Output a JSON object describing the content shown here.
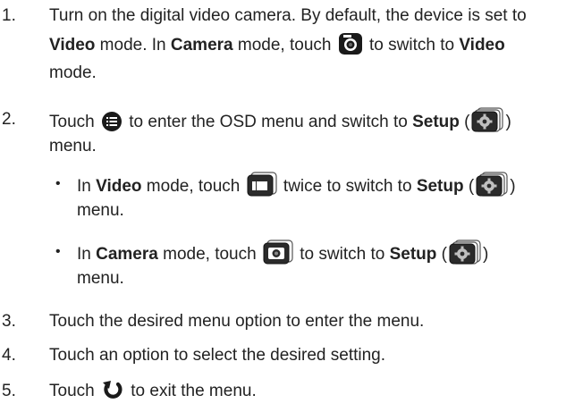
{
  "steps": [
    {
      "number": "1.",
      "line1": "Turn on the digital video camera. By default, the device is set to",
      "line2_mode1": "Video",
      "line2_mid": " mode. In ",
      "line2_mode2": "Camera",
      "line2_touch": " mode, touch ",
      "line2_after": " to switch to ",
      "line2_mode3": "Video",
      "line3": "mode.",
      "icon": "camera-mode-icon"
    },
    {
      "number": "2.",
      "touch": "Touch ",
      "after_icon": " to enter the OSD menu and switch to ",
      "setup": "Setup",
      "open_paren": " (",
      "close_paren": ")",
      "line2": "menu.",
      "icon": "menu-list-icon",
      "setup_icon": "setup-gear-icon",
      "bullets": [
        {
          "in": "In ",
          "mode": "Video",
          "touch": " mode, touch ",
          "after": " twice to switch to ",
          "setup": "Setup",
          "open_paren": " (",
          "close_paren": ")",
          "line2": "menu.",
          "icon": "video-tab-icon"
        },
        {
          "in": "In ",
          "mode": "Camera",
          "touch": " mode, touch ",
          "after": " to switch to ",
          "setup": "Setup",
          "open_paren": " (",
          "close_paren": ")",
          "line2": "menu.",
          "icon": "camera-tab-icon"
        }
      ]
    },
    {
      "number": "3.",
      "text": "Touch the desired menu option to enter the menu."
    },
    {
      "number": "4.",
      "text": "Touch an option to select the desired setting."
    },
    {
      "number": "5.",
      "touch": "Touch ",
      "after": " to exit the menu.",
      "icon": "return-arrow-icon"
    }
  ],
  "bullet_char": "•"
}
